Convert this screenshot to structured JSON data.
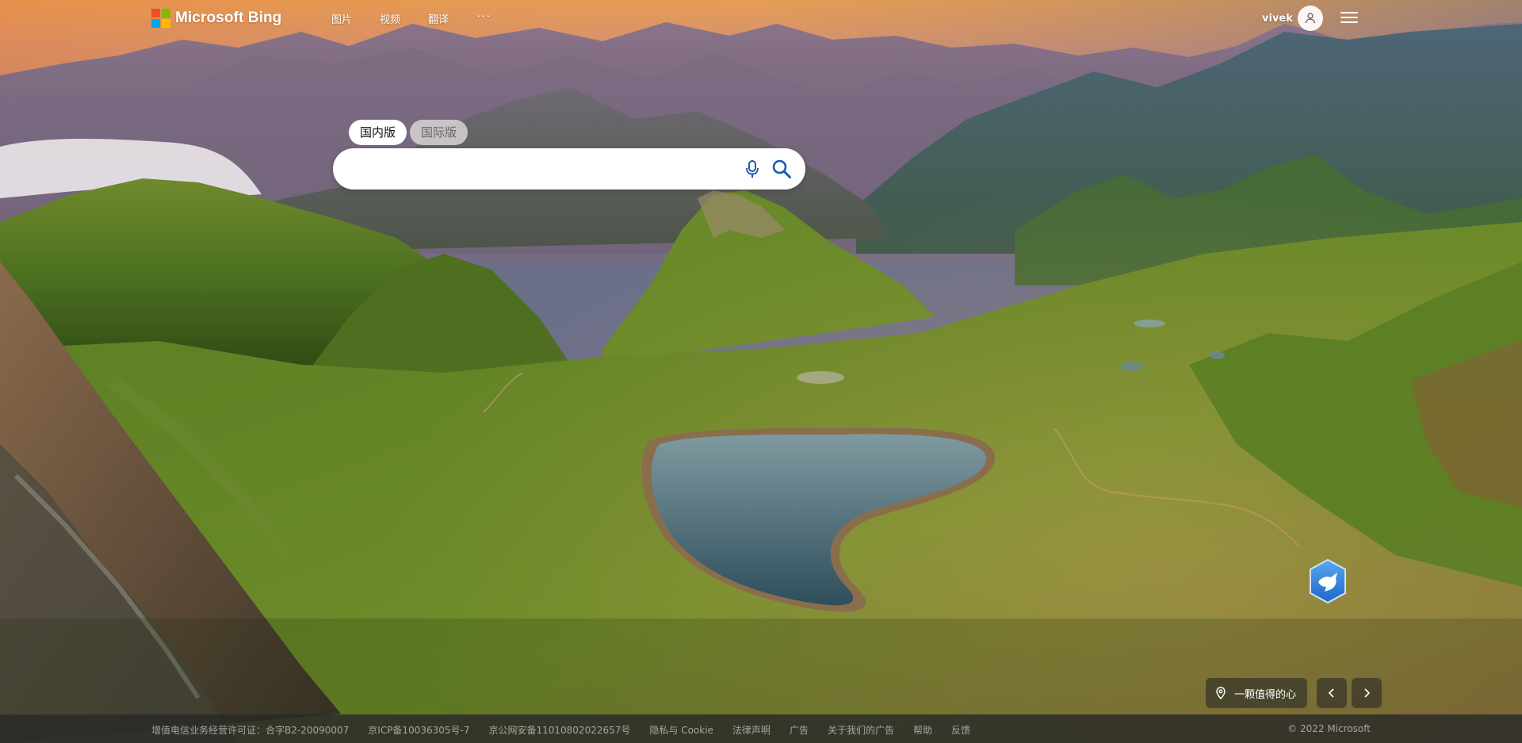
{
  "header": {
    "logo_text": "Microsoft Bing",
    "nav": [
      {
        "label": "图片"
      },
      {
        "label": "视频"
      },
      {
        "label": "翻译"
      },
      {
        "label": "···"
      }
    ],
    "account_name": "vivek"
  },
  "search": {
    "tabs": [
      {
        "label": "国内版",
        "active": true
      },
      {
        "label": "国际版",
        "active": false
      }
    ],
    "value": "",
    "placeholder": ""
  },
  "image_info": {
    "location_label": "一颗值得的心"
  },
  "footer": {
    "items": [
      {
        "label": "增值电信业务经营许可证：合字B2-20090007",
        "link": false
      },
      {
        "label": "京ICP备10036305号-7",
        "link": true
      },
      {
        "label": "京公网安备11010802022657号",
        "link": true
      },
      {
        "label": "隐私与 Cookie",
        "link": true
      },
      {
        "label": "法律声明",
        "link": true
      },
      {
        "label": "广告",
        "link": true
      },
      {
        "label": "关于我们的广告",
        "link": true
      },
      {
        "label": "帮助",
        "link": true
      },
      {
        "label": "反馈",
        "link": true
      }
    ],
    "copyright": "© 2022 Microsoft"
  },
  "colors": {
    "ms_red": "#f25022",
    "ms_green": "#7fba00",
    "ms_blue": "#00a4ef",
    "ms_yellow": "#ffb900",
    "bing_blue": "#1a5aad"
  },
  "icons": {
    "mic": "microphone-icon",
    "search": "magnifier-icon",
    "location": "map-pin-icon",
    "prev": "chevron-left-icon",
    "next": "chevron-right-icon",
    "avatar": "person-icon",
    "menu": "hamburger-icon",
    "ai_badge": "bird-hexagon-icon"
  }
}
